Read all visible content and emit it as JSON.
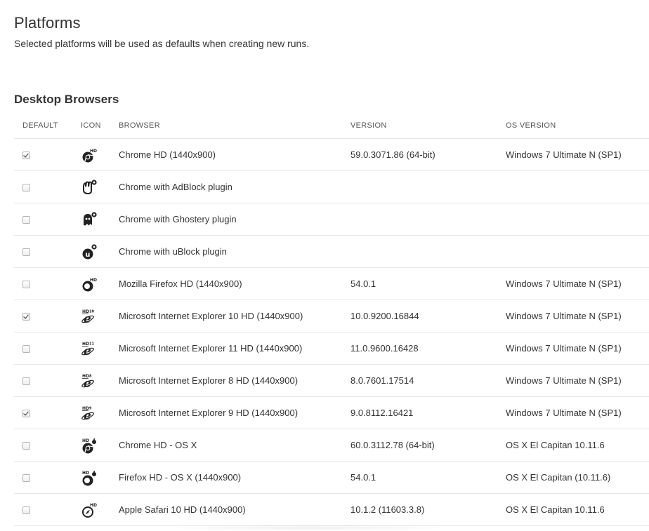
{
  "page": {
    "title": "Platforms",
    "subtitle": "Selected platforms will be used as defaults when creating new runs."
  },
  "section": {
    "title": "Desktop Browsers"
  },
  "table": {
    "headers": {
      "default": "DEFAULT",
      "icon": "ICON",
      "browser": "BROWSER",
      "version": "VERSION",
      "os": "OS VERSION"
    },
    "rows": [
      {
        "checked": true,
        "icon": "chrome-hd-icon",
        "badge": "HD",
        "browser": "Chrome HD (1440x900)",
        "version": "59.0.3071.86 (64-bit)",
        "os": "Windows 7 Ultimate N (SP1)"
      },
      {
        "checked": false,
        "icon": "adblock-hand-icon",
        "badge": "",
        "browser": "Chrome with AdBlock plugin",
        "version": "",
        "os": ""
      },
      {
        "checked": false,
        "icon": "ghostery-ghost-icon",
        "badge": "",
        "browser": "Chrome with Ghostery plugin",
        "version": "",
        "os": ""
      },
      {
        "checked": false,
        "icon": "ublock-u-icon",
        "badge": "",
        "browser": "Chrome with uBlock plugin",
        "version": "",
        "os": ""
      },
      {
        "checked": false,
        "icon": "firefox-hd-icon",
        "badge": "HD",
        "browser": "Mozilla Firefox HD (1440x900)",
        "version": "54.0.1",
        "os": "Windows 7 Ultimate N (SP1)"
      },
      {
        "checked": true,
        "icon": "ie10-hd-icon",
        "badge": "HD_10",
        "browser": "Microsoft Internet Explorer 10 HD (1440x900)",
        "version": "10.0.9200.16844",
        "os": "Windows 7 Ultimate N (SP1)"
      },
      {
        "checked": false,
        "icon": "ie11-hd-icon",
        "badge": "HD_11",
        "browser": "Microsoft Internet Explorer 11 HD (1440x900)",
        "version": "11.0.9600.16428",
        "os": "Windows 7 Ultimate N (SP1)"
      },
      {
        "checked": false,
        "icon": "ie8-hd-icon",
        "badge": "HD_8",
        "browser": "Microsoft Internet Explorer 8 HD (1440x900)",
        "version": "8.0.7601.17514",
        "os": "Windows 7 Ultimate N (SP1)"
      },
      {
        "checked": true,
        "icon": "ie9-hd-icon",
        "badge": "HD_9",
        "browser": "Microsoft Internet Explorer 9 HD (1440x900)",
        "version": "9.0.8112.16421",
        "os": "Windows 7 Ultimate N (SP1)"
      },
      {
        "checked": false,
        "icon": "chrome-hd-osx-icon",
        "badge": "HD",
        "browser": "Chrome HD - OS X",
        "version": "60.0.3112.78 (64-bit)",
        "os": "OS X El Capitan 10.11.6"
      },
      {
        "checked": false,
        "icon": "firefox-hd-osx-icon",
        "badge": "HD",
        "browser": "Firefox HD - OS X (1440x900)",
        "version": "54.0.1",
        "os": "OS X El Capitan (10.11.6)"
      },
      {
        "checked": false,
        "icon": "safari-hd-icon",
        "badge": "HD",
        "browser": "Apple Safari 10 HD (1440x900)",
        "version": "10.1.2 (11603.3.8)",
        "os": "OS X El Capitan 10.11.6"
      }
    ]
  }
}
